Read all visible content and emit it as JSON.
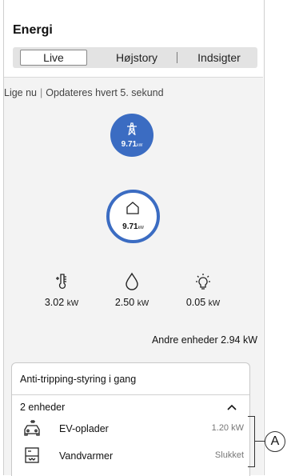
{
  "header": {
    "title": "Energi",
    "tabs": [
      {
        "label": "Live",
        "active": true
      },
      {
        "label": "Højstory",
        "active": false
      },
      {
        "label": "Indsigter",
        "active": false
      }
    ]
  },
  "status": {
    "now": "Lige nu",
    "updates": "Opdateres hvert 5. sekund"
  },
  "grid": {
    "icon": "grid-tower-icon",
    "value": "9.71",
    "unit": "kW"
  },
  "home": {
    "icon": "house-icon",
    "value": "9.71",
    "unit": "kW"
  },
  "categories": [
    {
      "icon": "thermometer-icon",
      "value": "3.02",
      "unit": "kW"
    },
    {
      "icon": "water-drop-icon",
      "value": "2.50",
      "unit": "kW"
    },
    {
      "icon": "light-bulb-icon",
      "value": "0.05",
      "unit": "kW"
    }
  ],
  "other_devices": {
    "label": "Andre enheder",
    "value": "2.94 kW"
  },
  "anti_tripping": {
    "title": "Anti-tripping-styring i gang",
    "count": "2 enheder",
    "devices": [
      {
        "icon": "ev-charger-icon",
        "name": "EV-oplader",
        "state": "1.20 kW"
      },
      {
        "icon": "water-heater-icon",
        "name": "Vandvarmer",
        "state": "Slukket"
      }
    ]
  },
  "callout": {
    "label": "A"
  },
  "colors": {
    "accent": "#3b6cc2",
    "tab_bg": "#e3e3e3",
    "panel_bg": "#f3f3f3"
  }
}
